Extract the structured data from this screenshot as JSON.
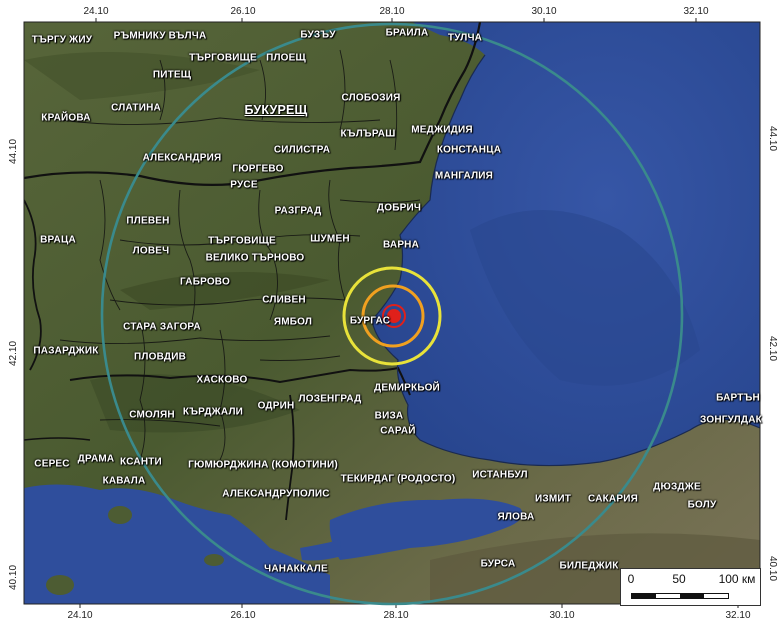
{
  "map": {
    "top_ticks": [
      "24.10",
      "26.10",
      "28.10",
      "30.10",
      "32.10"
    ],
    "bottom_ticks": [
      "24.10",
      "26.10",
      "28.10",
      "30.10",
      "32.10"
    ],
    "left_ticks": [
      "44.10",
      "42.10",
      "40.10"
    ],
    "right_ticks": [
      "44.10",
      "42.10",
      "40.10"
    ],
    "capital": "БУКУРЕЩ",
    "labels": {
      "targu_jiu": "ТЪРГУ ЖИУ",
      "ramnicu_valcea": "РЪМНИКУ ВЪЛЧА",
      "targoviste_ro": "ТЪРГОВИЩЕ",
      "ploesti": "ПЛОЕЩ",
      "buzau": "БУЗЪУ",
      "braila": "БРАИЛА",
      "tulcea": "ТУЛЧА",
      "pitesti": "ПИТЕЩ",
      "slatina": "СЛАТИНА",
      "craiova": "КРАЙОВА",
      "slobozia": "СЛОБОЗИЯ",
      "calarasi": "КЪЛЪРАШ",
      "medgidia": "МЕДЖИДИЯ",
      "constanta": "КОНСТАНЦА",
      "mangalia": "МАНГАЛИЯ",
      "silistra": "СИЛИСТРА",
      "alexandria": "АЛЕКСАНДРИЯ",
      "giurgiu": "ГЮРГЕВО",
      "ruse": "РУСЕ",
      "razgrad": "РАЗГРАД",
      "dobrich": "ДОБРИЧ",
      "shumen": "ШУМЕН",
      "varna": "ВАРНА",
      "pleven": "ПЛЕВЕН",
      "vratsa": "ВРАЦА",
      "lovech": "ЛОВЕЧ",
      "targovishte": "ТЪРГОВИЩЕ",
      "veliko_tarnovo": "ВЕЛИКО ТЪРНОВО",
      "gabrovo": "ГАБРОВО",
      "sliven": "СЛИВЕН",
      "stara_zagora": "СТАРА ЗАГОРА",
      "yambol": "ЯМБОЛ",
      "burgas": "БУРГАС",
      "pazardzhik": "ПАЗАРДЖИК",
      "plovdiv": "ПЛОВДИВ",
      "haskovo": "ХАСКОВО",
      "demirkoy": "ДЕМИРКЬОЙ",
      "smolyan": "СМОЛЯН",
      "kardzhali": "КЪРДЖАЛИ",
      "odrin": "ОДРИН",
      "lozengrad": "ЛОЗЕНГРАД",
      "viza": "ВИЗА",
      "saray": "САРАЙ",
      "bartin": "БАРТЪН",
      "zonguldak": "ЗОНГУЛДАК",
      "seres": "СЕРЕС",
      "drama": "ДРАМА",
      "ksanti": "КСАНТИ",
      "komotini": "ГЮМЮРДЖИНА (КОМОТИНИ)",
      "kavala": "КАВАЛА",
      "tekirdag": "ТЕКИРДАГ (РОДОСТО)",
      "istanbul": "ИСТАНБУЛ",
      "alexandroupolis": "АЛЕКСАНДРУПОЛИС",
      "izmit": "ИЗМИТ",
      "sakarya": "САКАРИЯ",
      "duzce": "ДЮЗДЖЕ",
      "bolu": "БОЛУ",
      "yalova": "ЯЛОВА",
      "canakkale": "ЧАНАККАЛЕ",
      "bursa": "БУРСА",
      "bilecik": "БИЛЕДЖИК"
    },
    "rings": [
      {
        "name": "outer",
        "color": "#3a8a8c"
      },
      {
        "name": "yellow",
        "color": "#e8e23a"
      },
      {
        "name": "orange",
        "color": "#f0a020"
      },
      {
        "name": "red",
        "color": "#e0201a"
      }
    ],
    "epicenter_color": "#e0201a",
    "sea_color": "#2e4f9e",
    "land_color": "#4d5c33"
  },
  "scale": {
    "labels": [
      "0",
      "50",
      "100 км"
    ]
  }
}
